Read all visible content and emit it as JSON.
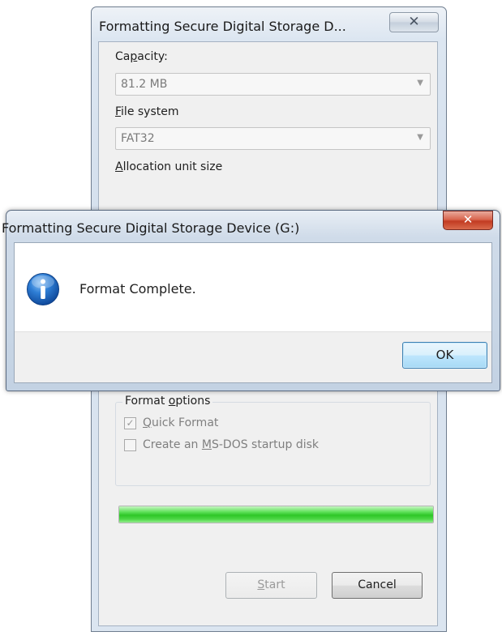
{
  "format_window": {
    "title": "Formatting Secure Digital Storage D...",
    "close_glyph": "✕",
    "capacity": {
      "label_pre": "Ca",
      "label_mn": "p",
      "label_post": "acity:",
      "value": "81.2 MB"
    },
    "file_system": {
      "label_mn": "F",
      "label_post": "ile system",
      "value": "FAT32"
    },
    "allocation": {
      "label_mn": "A",
      "label_post": "llocation unit size"
    },
    "format_options": {
      "legend_pre": "Format ",
      "legend_mn": "o",
      "legend_post": "ptions",
      "quick_format": {
        "mn": "Q",
        "label": "uick Format",
        "checked": true
      },
      "msdos": {
        "pre": "Create an ",
        "mn": "M",
        "post": "S-DOS startup disk",
        "checked": false
      }
    },
    "progress_percent": 100,
    "start_button": {
      "mn": "S",
      "label": "tart"
    },
    "cancel_button": "Cancel"
  },
  "message_box": {
    "title": "Formatting Secure Digital Storage Device (G:)",
    "close_glyph": "✕",
    "icon": "info-icon",
    "message": "Format Complete.",
    "ok_button": "OK"
  },
  "colors": {
    "progress_green": "#2ec627",
    "window_frame": "#dce6f1",
    "close_red": "#c23b22",
    "info_blue": "#1d5fb5"
  }
}
